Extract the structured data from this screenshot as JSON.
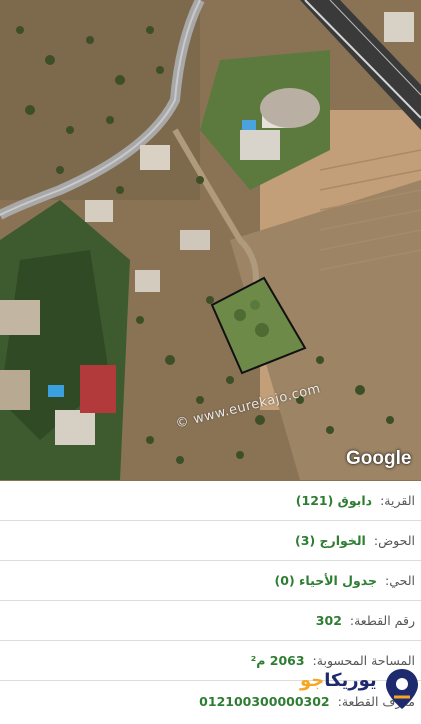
{
  "map": {
    "watermark": "© www.eurekajo.com",
    "provider": "Google"
  },
  "parcel": {
    "village_label": "القرية:",
    "village_value": "دابوق (121)",
    "basin_label": "الحوض:",
    "basin_value": "الخوارج (3)",
    "district_label": "الحي:",
    "district_value": "جدول الأحياء (0)",
    "plot_label": "رقم القطعة:",
    "plot_value": "302",
    "area_label": "المساحة المحسوبة:",
    "area_value": "2063 م²",
    "id_label": "معرف القطعة:",
    "id_value": "012100300000302"
  },
  "brand": {
    "name_main": "يوريكا",
    "name_accent": "جو",
    "icon": "location-pin-icon"
  },
  "colors": {
    "value_green": "#2e7d32",
    "brand_navy": "#1e2a6e",
    "brand_orange": "#f5a623"
  }
}
